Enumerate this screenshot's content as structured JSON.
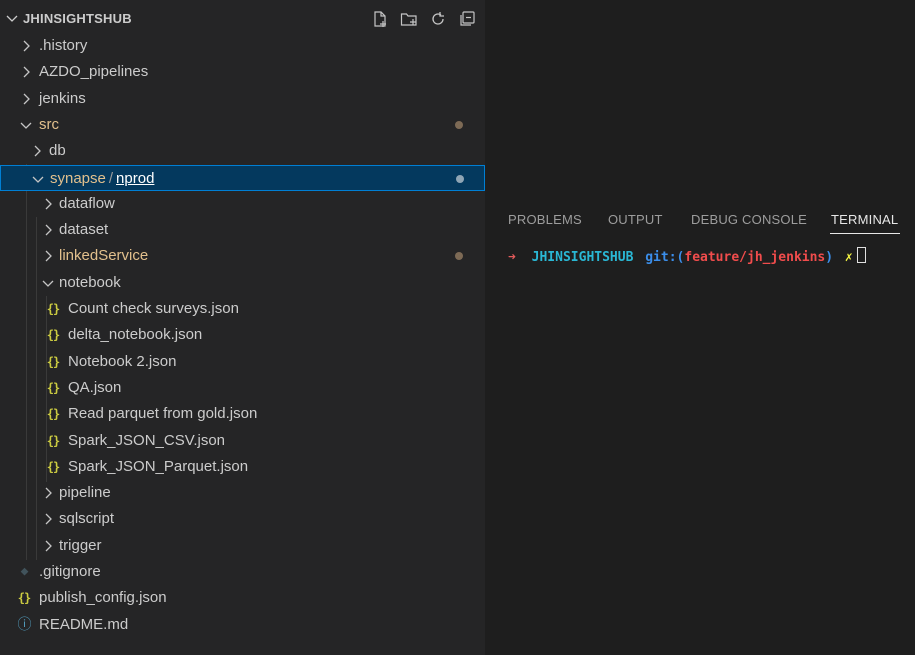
{
  "explorer": {
    "title": "JHINSIGHTSHUB",
    "actions": [
      {
        "name": "new-file-icon"
      },
      {
        "name": "new-folder-icon"
      },
      {
        "name": "refresh-icon"
      },
      {
        "name": "collapse-all-icon"
      }
    ],
    "tree": [
      {
        "label": ".history",
        "type": "folder",
        "expanded": false,
        "depth": 0
      },
      {
        "label": "AZDO_pipelines",
        "type": "folder",
        "expanded": false,
        "depth": 0
      },
      {
        "label": "jenkins",
        "type": "folder",
        "expanded": false,
        "depth": 0
      },
      {
        "label": "src",
        "type": "folder",
        "expanded": true,
        "depth": 0,
        "color": "#e2c08d",
        "modified": true
      },
      {
        "label": "db",
        "type": "folder",
        "expanded": false,
        "depth": 1
      },
      {
        "label": "synapse",
        "label_sep": "/",
        "label_b": "nprod",
        "type": "folder",
        "expanded": true,
        "depth": 1,
        "selected": true,
        "modified": true
      },
      {
        "label": "dataflow",
        "type": "folder",
        "expanded": false,
        "depth": 2
      },
      {
        "label": "dataset",
        "type": "folder",
        "expanded": false,
        "depth": 2
      },
      {
        "label": "linkedService",
        "type": "folder",
        "expanded": false,
        "depth": 2,
        "color": "#e2c08d",
        "modified": true
      },
      {
        "label": "notebook",
        "type": "folder",
        "expanded": true,
        "depth": 2
      },
      {
        "label": "Count check surveys.json",
        "type": "json",
        "depth": 3
      },
      {
        "label": "delta_notebook.json",
        "type": "json",
        "depth": 3
      },
      {
        "label": "Notebook 2.json",
        "type": "json",
        "depth": 3
      },
      {
        "label": "QA.json",
        "type": "json",
        "depth": 3
      },
      {
        "label": "Read parquet from gold.json",
        "type": "json",
        "depth": 3
      },
      {
        "label": "Spark_JSON_CSV.json",
        "type": "json",
        "depth": 3
      },
      {
        "label": "Spark_JSON_Parquet.json",
        "type": "json",
        "depth": 3
      },
      {
        "label": "pipeline",
        "type": "folder",
        "expanded": false,
        "depth": 2
      },
      {
        "label": "sqlscript",
        "type": "folder",
        "expanded": false,
        "depth": 2
      },
      {
        "label": "trigger",
        "type": "folder",
        "expanded": false,
        "depth": 2
      },
      {
        "label": ".gitignore",
        "type": "git",
        "depth": 0
      },
      {
        "label": "publish_config.json",
        "type": "json",
        "depth": 0
      },
      {
        "label": "README.md",
        "type": "info",
        "depth": 0
      }
    ]
  },
  "panel": {
    "tabs": [
      {
        "label": "PROBLEMS",
        "active": false
      },
      {
        "label": "OUTPUT",
        "active": false
      },
      {
        "label": "DEBUG CONSOLE",
        "active": false
      },
      {
        "label": "TERMINAL",
        "active": true
      }
    ],
    "terminal": {
      "arrow": "➜",
      "dir": "JHINSIGHTSHUB",
      "git_prefix": "git:(",
      "branch": "feature/jh_jenkins",
      "git_suffix": ")",
      "dirty_mark": "✗"
    }
  },
  "colors": {
    "selection_bg": "#04395e",
    "selection_border": "#007fd4",
    "modified_text": "#e2c08d",
    "json_icon": "#cbcb41",
    "prompt_arrow": "#e35b5b",
    "prompt_dir": "#2ab7d4",
    "prompt_git": "#3b8eea",
    "prompt_branch": "#f14c4c",
    "prompt_dirty": "#f5f543"
  }
}
